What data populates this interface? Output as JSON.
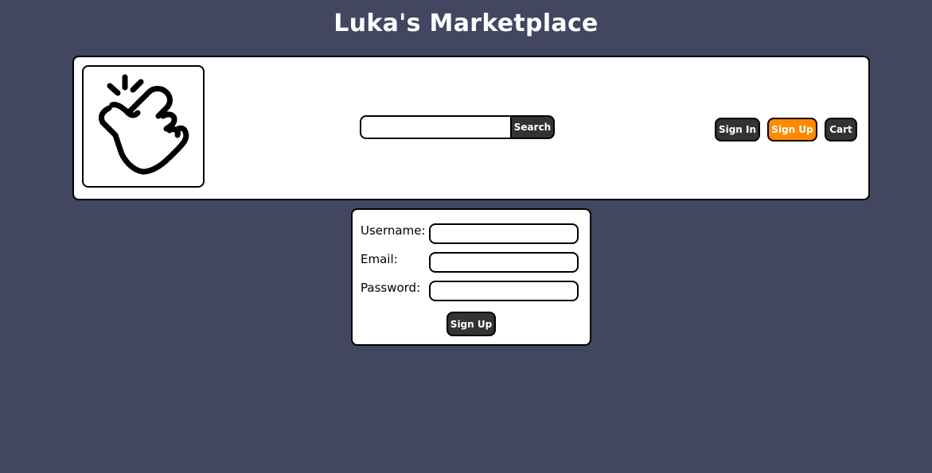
{
  "app": {
    "title": "Luka's Marketplace",
    "logo_icon": "snap-fingers-hand-icon"
  },
  "header": {
    "search": {
      "value": "",
      "placeholder": "",
      "button_label": "Search"
    },
    "nav": {
      "sign_in": "Sign In",
      "sign_up": "Sign Up",
      "cart": "Cart"
    }
  },
  "signup_form": {
    "username_label": "Username:",
    "username_value": "",
    "email_label": "Email:",
    "email_value": "",
    "password_label": "Password:",
    "password_value": "",
    "submit_label": "Sign Up"
  },
  "colors": {
    "background": "#434660",
    "panel": "#ffffff",
    "button_dark": "#333333",
    "accent_orange": "#ff8a00"
  }
}
